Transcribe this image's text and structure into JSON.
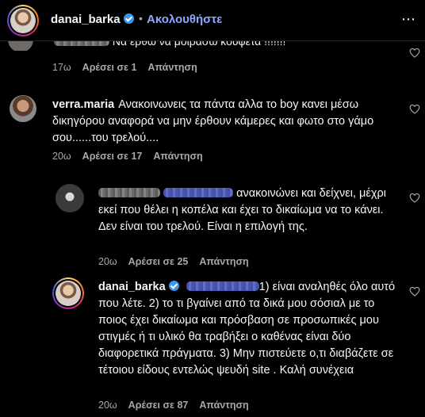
{
  "header": {
    "username": "danai_barka",
    "separator": "•",
    "follow_label": "Ακολουθήστε",
    "more_icon": "⋯"
  },
  "comments": [
    {
      "username": "",
      "text": "Να έρθω να μοιράσω κουφέτα !!!!!!!",
      "time": "17ω",
      "likes": "Αρέσει σε 1",
      "reply": "Απάντηση"
    },
    {
      "username": "verra.maria",
      "text": "Ανακοινωνεις τα πάντα αλλα το boy κανει μέσω δικηγόρου αναφορά να μην έρθουν κάμερες και φωτο στο γάμο σου......του τρελού....",
      "time": "20ω",
      "likes": "Αρέσει σε 17",
      "reply": "Απάντηση"
    },
    {
      "username": "",
      "text": "ανακοινώνει και δείχνει, μέχρι εκεί που θέλει η κοπέλα και έχει το δικαίωμα να το κάνει. Δεν είναι του τρελού. Είναι η επιλογή της.",
      "time": "20ω",
      "likes": "Αρέσει σε 25",
      "reply": "Απάντηση"
    },
    {
      "username": "danai_barka",
      "text": "1) είναι αναληθές όλο αυτό που λέτε. 2) το τι βγαίνει από τα δικά μου σόσιαλ με το ποιος έχει δικαίωμα και πρόσβαση σε προσωπικές μου στιγμές ή τι υλικό θα τραβήξει ο καθένας είναι δύο διαφορετικά πράγματα. 3) Μην πιστεύετε ο,τι διαβάζετε σε τέτοιου είδους εντελώς ψευδή site . Καλή συνέχεια",
      "time": "20ω",
      "likes": "Αρέσει σε 87",
      "reply": "Απάντηση"
    }
  ],
  "icons": {
    "like": "heart-outline-icon",
    "verified": "verified-badge-icon",
    "more": "more-options-icon"
  },
  "colors": {
    "background": "#000000",
    "text": "#f5f5f5",
    "muted": "#a8a8a8",
    "link": "#8fa7ff",
    "verified": "#3897f0"
  }
}
